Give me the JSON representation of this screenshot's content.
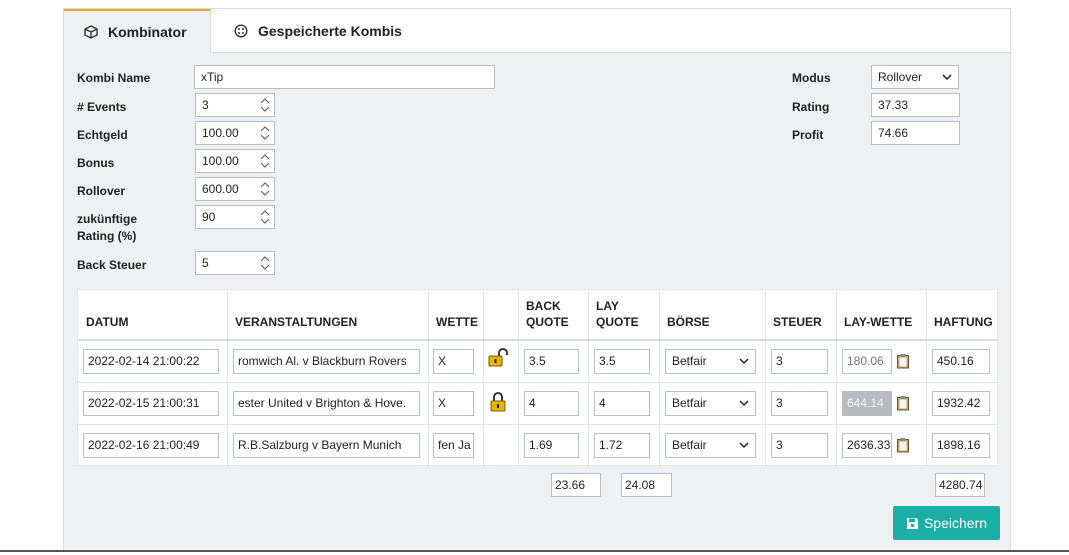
{
  "tabs": [
    {
      "label": "Kombinator",
      "active": true,
      "icon": "cube-icon"
    },
    {
      "label": "Gespeicherte Kombis",
      "active": false,
      "icon": "dice-icon"
    }
  ],
  "form": {
    "kombi_name_label": "Kombi Name",
    "kombi_name_value": "xTip",
    "events_label": "# Events",
    "events_value": "3",
    "echtgeld_label": "Echtgeld",
    "echtgeld_value": "100.00",
    "bonus_label": "Bonus",
    "bonus_value": "100.00",
    "rollover_label": "Rollover",
    "rollover_value": "600.00",
    "rating_future_label_1": "zukünftige",
    "rating_future_label_2": "Rating (%)",
    "rating_future_value": "90",
    "back_steuer_label": "Back Steuer",
    "back_steuer_value": "5"
  },
  "right_form": {
    "modus_label": "Modus",
    "modus_value": "Rollover",
    "rating_label": "Rating",
    "rating_value": "37.33",
    "profit_label": "Profit",
    "profit_value": "74.66"
  },
  "table": {
    "headers": {
      "datum": "DATUM",
      "veranstaltungen": "VERANSTALTUNGEN",
      "wette": "WETTE",
      "back_1": "BACK",
      "back_2": "QUOTE",
      "lay_1": "LAY",
      "lay_2": "QUOTE",
      "boerse": "BÖRSE",
      "steuer": "STEUER",
      "lay_wette": "LAY-WETTE",
      "haftung": "HAFTUNG"
    },
    "rows": [
      {
        "datum": "2022-02-14 21:00:22",
        "event": "romwich Al. v Blackburn Rovers",
        "wette": "X",
        "lock": "unlocked",
        "back": "3.5",
        "lay": "3.5",
        "boerse": "Betfair",
        "steuer": "3",
        "lay_wette": "180.06",
        "haftung": "450.16"
      },
      {
        "datum": "2022-02-15 21:00:31",
        "event": "ester United v Brighton & Hove.",
        "wette": "X",
        "lock": "locked",
        "back": "4",
        "lay": "4",
        "boerse": "Betfair",
        "steuer": "3",
        "lay_wette": "644.14",
        "haftung": "1932.42"
      },
      {
        "datum": "2022-02-16 21:00:49",
        "event": "R.B.Salzburg v Bayern Munich",
        "wette": "fen Ja",
        "lock": "none",
        "back": "1.69",
        "lay": "1.72",
        "boerse": "Betfair",
        "steuer": "3",
        "lay_wette": "2636.33",
        "haftung": "1898.16"
      }
    ],
    "totals": {
      "back": "23.66",
      "lay": "24.08",
      "haftung": "4280.74"
    }
  },
  "save_button": {
    "label": "Speichern",
    "icon": "floppy-icon",
    "color": "#1aaea4"
  },
  "colors": {
    "accent_tab": "#e5a92a",
    "lock_gold": "#e8b600"
  }
}
